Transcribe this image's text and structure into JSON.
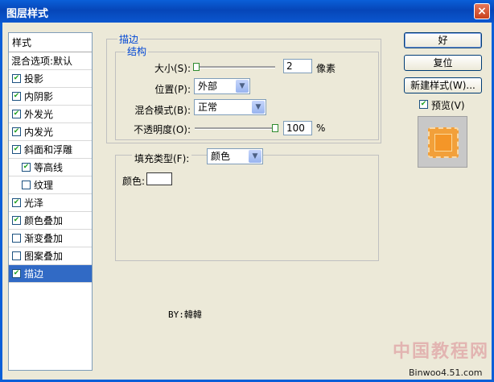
{
  "window": {
    "title": "图层样式",
    "close_glyph": "×"
  },
  "style_list": {
    "header": "样式",
    "blend_options": "混合选项:默认",
    "items": [
      {
        "label": "投影",
        "checked": true
      },
      {
        "label": "内阴影",
        "checked": true
      },
      {
        "label": "外发光",
        "checked": true
      },
      {
        "label": "内发光",
        "checked": true
      },
      {
        "label": "斜面和浮雕",
        "checked": true
      },
      {
        "label": "等高线",
        "checked": true,
        "indent": true
      },
      {
        "label": "纹理",
        "checked": false,
        "indent": true
      },
      {
        "label": "光泽",
        "checked": true
      },
      {
        "label": "颜色叠加",
        "checked": true
      },
      {
        "label": "渐变叠加",
        "checked": false
      },
      {
        "label": "图案叠加",
        "checked": false
      },
      {
        "label": "描边",
        "checked": true,
        "selected": true
      }
    ]
  },
  "stroke": {
    "group_title": "描边",
    "structure_title": "结构",
    "size_label": "大小(S):",
    "size_value": "2",
    "size_unit": "像素",
    "position_label": "位置(P):",
    "position_value": "外部",
    "blend_mode_label": "混合模式(B):",
    "blend_mode_value": "正常",
    "opacity_label": "不透明度(O):",
    "opacity_value": "100",
    "opacity_unit": "%",
    "opacity_level": 1.0,
    "size_level": 0.0,
    "fill_type_label": "填充类型(F):",
    "fill_type_value": "颜色",
    "color_label": "颜色:",
    "color_value": "#ffffff"
  },
  "buttons": {
    "ok": "好",
    "reset": "复位",
    "new_style": "新建样式(W)..."
  },
  "preview": {
    "label": "预览(V)",
    "checked": true
  },
  "signature": "BY:韓韓",
  "watermark": {
    "main": "中国教程网",
    "site": "Binwoo4.51.com"
  }
}
